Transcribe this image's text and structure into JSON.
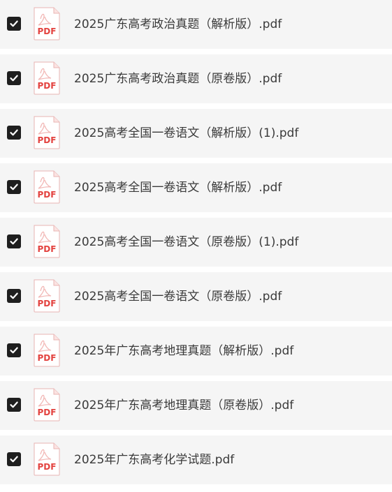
{
  "icon_label": "PDF",
  "colors": {
    "row_background": "#f5f5f5",
    "checkbox_fill": "#1f1f1f",
    "pdf_red": "#e3423f",
    "text": "#3a3a3a"
  },
  "files": [
    {
      "name": "2025广东高考政治真题（解析版）.pdf",
      "checked": true
    },
    {
      "name": "2025广东高考政治真题（原卷版）.pdf",
      "checked": true
    },
    {
      "name": "2025高考全国一卷语文（解析版）(1).pdf",
      "checked": true
    },
    {
      "name": "2025高考全国一卷语文（解析版）.pdf",
      "checked": true
    },
    {
      "name": "2025高考全国一卷语文（原卷版）(1).pdf",
      "checked": true
    },
    {
      "name": "2025高考全国一卷语文（原卷版）.pdf",
      "checked": true
    },
    {
      "name": "2025年广东高考地理真题（解析版）.pdf",
      "checked": true
    },
    {
      "name": "2025年广东高考地理真题（原卷版）.pdf",
      "checked": true
    },
    {
      "name": "2025年广东高考化学试题.pdf",
      "checked": true
    }
  ]
}
